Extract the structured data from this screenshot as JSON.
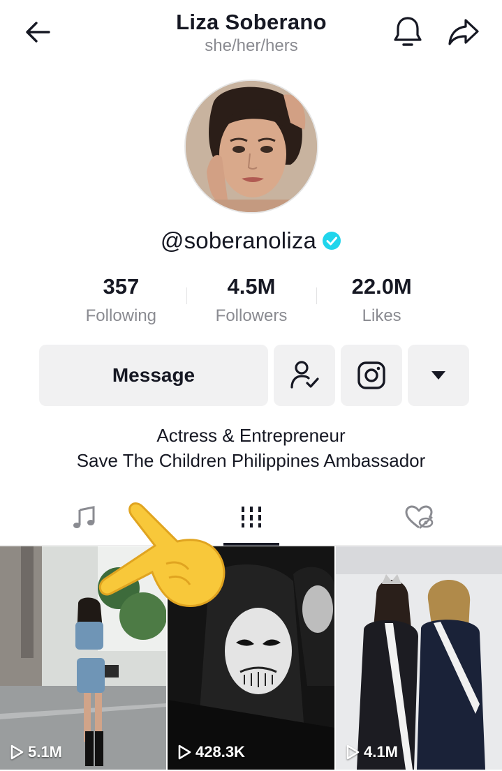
{
  "header": {
    "title": "Liza Soberano",
    "pronouns": "she/her/hers",
    "icons": {
      "back": "arrow-left-icon",
      "notifications": "bell-icon",
      "share": "share-arrow-icon"
    }
  },
  "profile": {
    "handle": "@soberanoliza",
    "verified_icon": "verified-badge-icon",
    "avatar": "profile-avatar"
  },
  "stats": [
    {
      "value": "357",
      "label": "Following"
    },
    {
      "value": "4.5M",
      "label": "Followers"
    },
    {
      "value": "22.0M",
      "label": "Likes"
    }
  ],
  "actions": {
    "message_label": "Message",
    "icons": [
      "followed-user-icon",
      "instagram-icon",
      "dropdown-triangle-icon"
    ]
  },
  "bio": {
    "line1": "Actress & Entrepreneur",
    "line2": "Save The Children Philippines Ambassador"
  },
  "tabs": [
    {
      "icon": "music-note-icon",
      "active": false
    },
    {
      "icon": "grid-videos-icon",
      "active": true
    },
    {
      "icon": "hidden-likes-icon",
      "active": false
    }
  ],
  "videos": [
    {
      "views": "5.1M"
    },
    {
      "views": "428.3K"
    },
    {
      "views": "4.1M"
    }
  ],
  "colors": {
    "text": "#161823",
    "secondary": "#8a8b91",
    "button_bg": "#f1f1f2",
    "verified": "#20d5ec"
  }
}
